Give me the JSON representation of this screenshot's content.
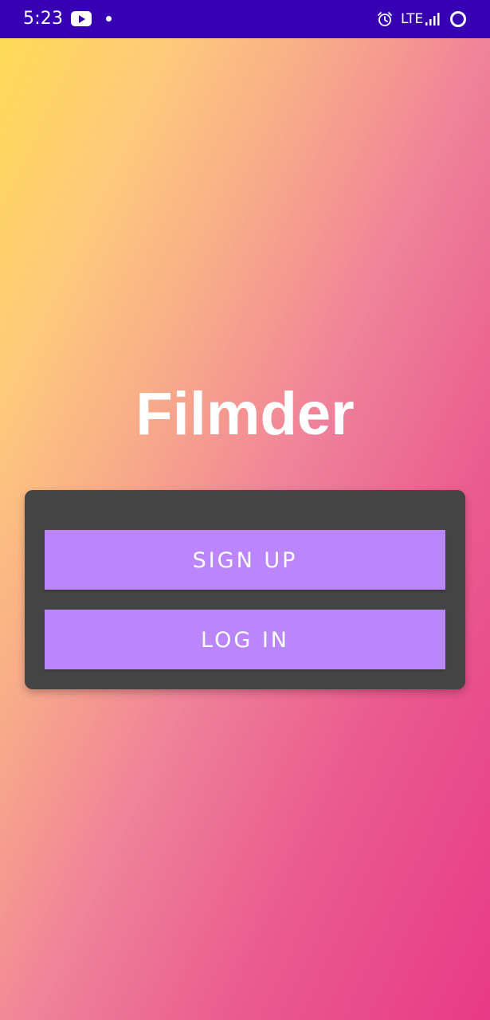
{
  "status_bar": {
    "time": "5:23",
    "network": "LTE",
    "background_color": "#3700b3",
    "icons": [
      "youtube-icon",
      "notification-dot-icon",
      "alarm-icon",
      "signal-icon",
      "battery-icon"
    ]
  },
  "app": {
    "title": "Filmder",
    "gradient_colors": [
      "#ffdc52",
      "#fdc97c",
      "#ef7f9a",
      "#e83a86"
    ]
  },
  "auth_card": {
    "background_color": "#444444",
    "signup_label": "SIGN UP",
    "login_label": "LOG IN",
    "button_color": "#bb86fc"
  }
}
